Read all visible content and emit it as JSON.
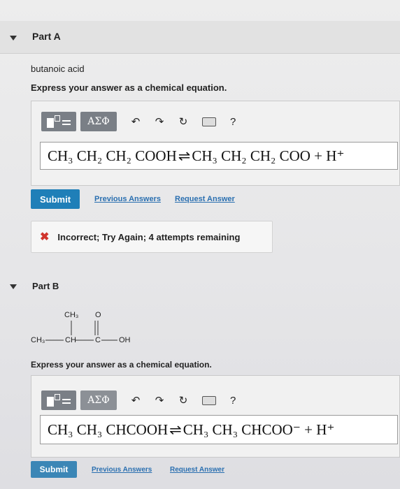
{
  "part_a": {
    "title": "Part A",
    "compound": "butanoic acid",
    "instruction": "Express your answer as a chemical equation.",
    "toolbar": {
      "greek_label": "ΑΣΦ",
      "undo_icon": "undo-icon",
      "redo_icon": "redo-icon",
      "reset_icon": "reset-icon",
      "keyboard_icon": "keyboard-icon",
      "help_label": "?"
    },
    "answer": {
      "reactant": "CH₃ CH₂ CH₂ COOH",
      "arrow": "⇌",
      "product": "CH₃ CH₂ CH₂ COO + H⁺"
    },
    "submit_label": "Submit",
    "previous_answers_label": "Previous Answers",
    "request_answer_label": "Request Answer",
    "feedback": "Incorrect; Try Again; 4 attempts remaining"
  },
  "part_b": {
    "title": "Part B",
    "structure": {
      "ch3_branch": "CH₃",
      "oxygen": "O",
      "ch3_left": "CH₃",
      "ch": "CH",
      "c": "C",
      "oh": "OH"
    },
    "instruction": "Express your answer as a chemical equation.",
    "toolbar": {
      "greek_label": "ΑΣΦ",
      "help_label": "?"
    },
    "answer": {
      "reactant": "CH₃ CH₃ CHCOOH",
      "arrow": "⇌",
      "product": "CH₃ CH₃ CHCOO⁻ + H⁺"
    },
    "submit_label": "Submit",
    "previous_answers_label": "Previous Answers",
    "request_answer_label": "Request Answer"
  },
  "colors": {
    "submit_blue": "#1f7fb8",
    "link_blue": "#2a6fb0",
    "error_red": "#d0342c",
    "toolbar_gray": "#7a7f86"
  }
}
